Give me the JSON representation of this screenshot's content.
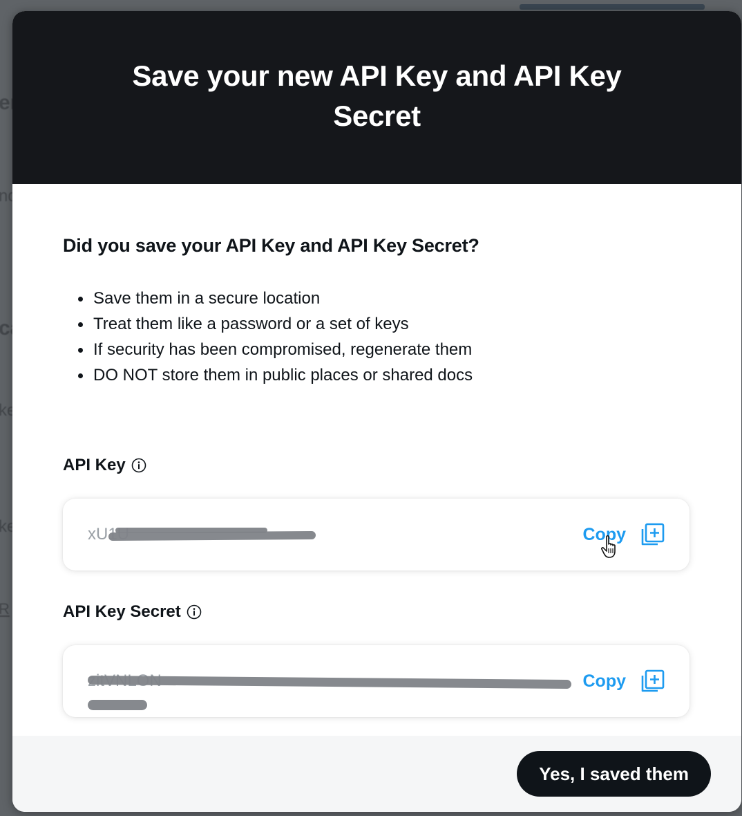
{
  "modal": {
    "title": "Save your new API Key and API Key Secret",
    "question": "Did you save your API Key and API Key Secret?",
    "tips": [
      "Save them in a secure location",
      "Treat them like a password or a set of keys",
      "If security has been compromised, regenerate them",
      "DO NOT store them in public places or shared docs"
    ],
    "api_key": {
      "label": "API Key",
      "value_visible": "xU1U",
      "value_redacted": true,
      "copy_label": "Copy"
    },
    "api_key_secret": {
      "label": "API Key Secret",
      "value_visible": "zitVNLON",
      "value_redacted": true,
      "copy_label": "Copy"
    },
    "confirm_label": "Yes, I saved them"
  },
  "colors": {
    "header_bg": "#15171b",
    "accent": "#1d9bf0",
    "button_bg": "#0f1419",
    "footer_bg": "#f5f6f7"
  },
  "icons": {
    "info": "info-circle-icon",
    "copy": "copy-plus-icon",
    "cursor": "hand-pointer-icon"
  }
}
